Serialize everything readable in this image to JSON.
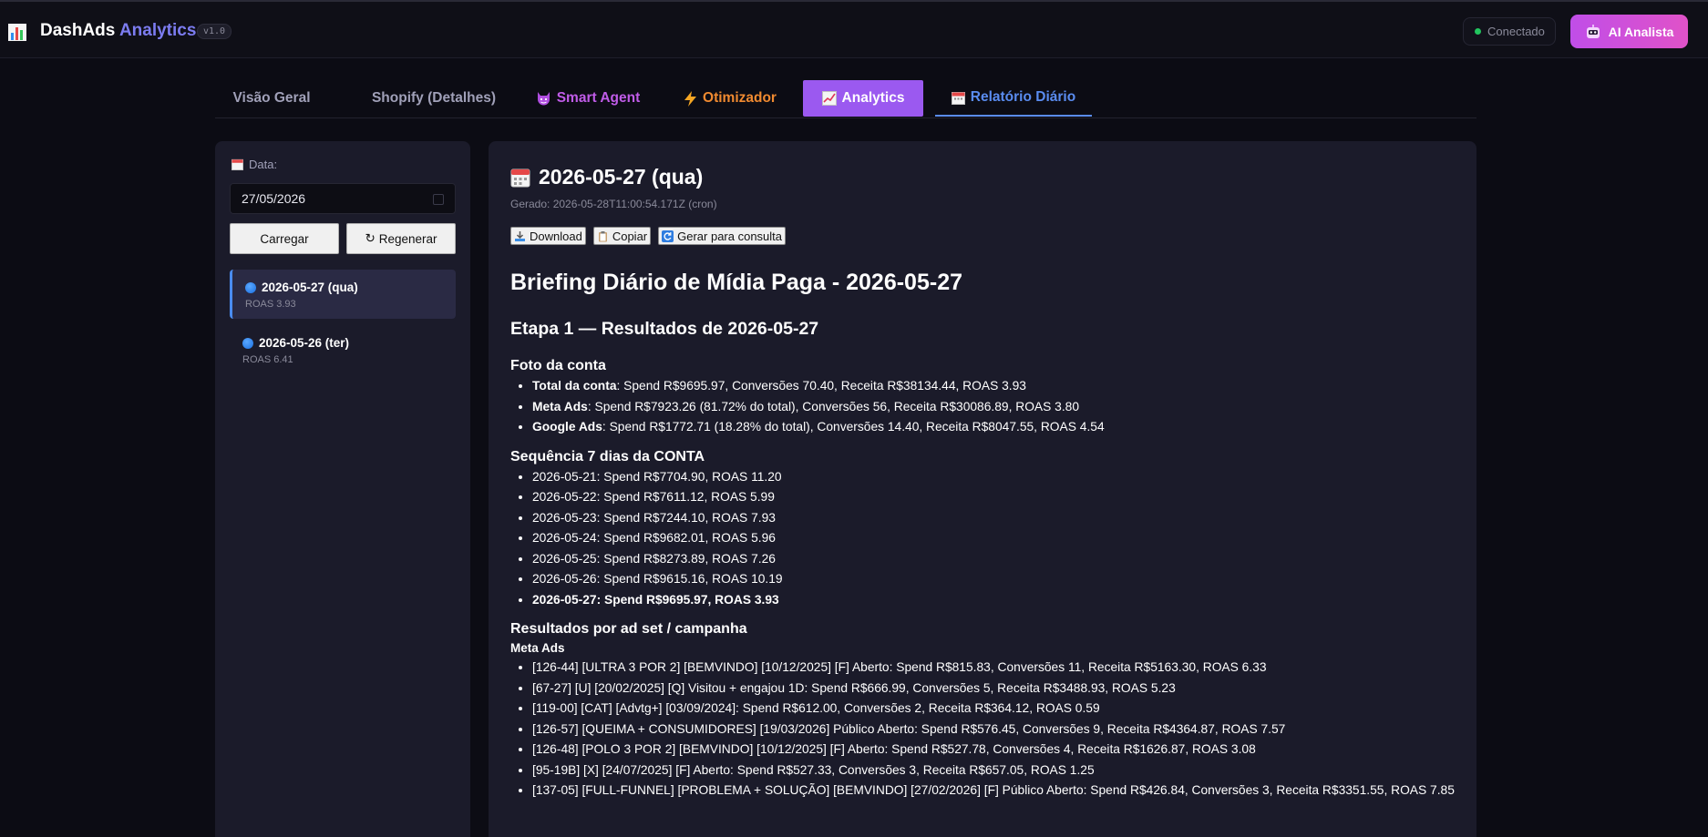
{
  "header": {
    "brand_main": "DashAds",
    "brand_accent": "Analytics",
    "version": "v1.0",
    "status": "Conectado",
    "ai_button": "AI Analista"
  },
  "tabs": [
    {
      "label": "Visão Geral"
    },
    {
      "label": "Shopify (Detalhes)"
    },
    {
      "label": "Smart Agent"
    },
    {
      "label": "Otimizador"
    },
    {
      "label": "Analytics"
    },
    {
      "label": "Relatório Diário"
    }
  ],
  "sidebar": {
    "date_label": "Data:",
    "date_value": "27/05/2026",
    "load_button": "Carregar",
    "regen_button": "Regenerar",
    "days": [
      {
        "title": "2026-05-27 (qua)",
        "sub": "ROAS 3.93"
      },
      {
        "title": "2026-05-26 (ter)",
        "sub": "ROAS 6.41"
      }
    ]
  },
  "main": {
    "title": "2026-05-27 (qua)",
    "generated": "Gerado: 2026-05-28T11:00:54.171Z (cron)",
    "actions": {
      "download": "Download",
      "copy": "Copiar",
      "generate": "Gerar para consulta"
    },
    "doc": {
      "h1": "Briefing Diário de Mídia Paga - 2026-05-27",
      "h2": "Etapa 1 — Resultados de 2026-05-27",
      "foto_title": "Foto da conta",
      "foto": [
        {
          "label": "Total da conta",
          "text": ": Spend R$9695.97, Conversões 70.40, Receita R$38134.44, ROAS 3.93"
        },
        {
          "label": "Meta Ads",
          "text": ": Spend R$7923.26 (81.72% do total), Conversões 56, Receita R$30086.89, ROAS 3.80"
        },
        {
          "label": "Google Ads",
          "text": ": Spend R$1772.71 (18.28% do total), Conversões 14.40, Receita R$8047.55, ROAS 4.54"
        }
      ],
      "seq_title": "Sequência 7 dias da CONTA",
      "seq": [
        "2026-05-21: Spend R$7704.90, ROAS 11.20",
        "2026-05-22: Spend R$7611.12, ROAS 5.99",
        "2026-05-23: Spend R$7244.10, ROAS 7.93",
        "2026-05-24: Spend R$9682.01, ROAS 5.96",
        "2026-05-25: Spend R$8273.89, ROAS 7.26",
        "2026-05-26: Spend R$9615.16, ROAS 10.19",
        "2026-05-27: Spend R$9695.97, ROAS 3.93"
      ],
      "res_title": "Resultados por ad set / campanha",
      "meta_title": "Meta Ads",
      "meta": [
        "[126-44] [ULTRA 3 POR 2] [BEMVINDO] [10/12/2025] [F] Aberto: Spend R$815.83, Conversões 11, Receita R$5163.30, ROAS 6.33",
        "[67-27] [U] [20/02/2025] [Q] Visitou + engajou 1D: Spend R$666.99, Conversões 5, Receita R$3488.93, ROAS 5.23",
        "[119-00] [CAT] [Advtg+] [03/09/2024]: Spend R$612.00, Conversões 2, Receita R$364.12, ROAS 0.59",
        "[126-57] [QUEIMA + CONSUMIDORES] [19/03/2026] Público Aberto: Spend R$576.45, Conversões 9, Receita R$4364.87, ROAS 7.57",
        "[126-48] [POLO 3 POR 2] [BEMVINDO] [10/12/2025] [F] Aberto: Spend R$527.78, Conversões 4, Receita R$1626.87, ROAS 3.08",
        "[95-19B] [X] [24/07/2025] [F] Aberto: Spend R$527.33, Conversões 3, Receita R$657.05, ROAS 1.25",
        "[137-05] [FULL-FUNNEL] [PROBLEMA + SOLUÇÃO] [BEMVINDO] [27/02/2026] [F] Público Aberto: Spend R$426.84, Conversões 3, Receita R$3351.55, ROAS 7.85"
      ]
    }
  }
}
